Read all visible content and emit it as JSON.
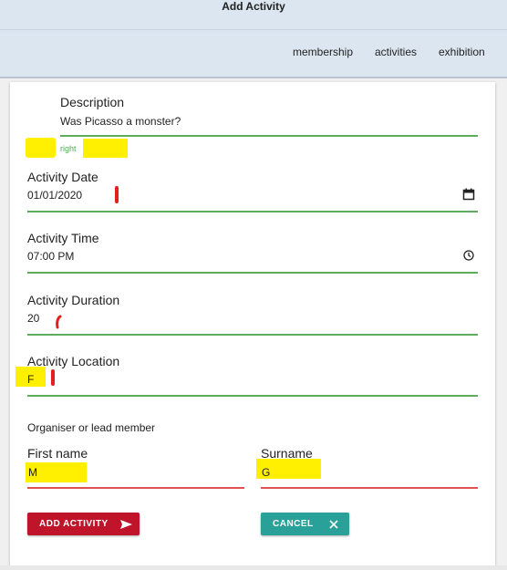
{
  "header": {
    "title": "Add Activity",
    "nav": [
      "membership",
      "activities",
      "exhibition"
    ]
  },
  "form": {
    "description": {
      "label": "Description",
      "value": "Was Picasso a monster?",
      "hint": "right"
    },
    "date": {
      "label": "Activity Date",
      "value": "01/01/2020"
    },
    "time": {
      "label": "Activity Time",
      "value": "07:00 PM"
    },
    "duration": {
      "label": "Activity Duration",
      "value": "20"
    },
    "location": {
      "label": "Activity Location",
      "value": "F"
    },
    "organiser_heading": "Organiser or lead member",
    "first_name": {
      "label": "First name",
      "value": "M"
    },
    "surname": {
      "label": "Surname",
      "value": "G"
    }
  },
  "buttons": {
    "add": "ADD ACTIVITY",
    "cancel": "CANCEL"
  },
  "colors": {
    "valid": "#5cac5c",
    "invalid": "#e05252",
    "add": "#c0142b",
    "cancel": "#2aa198",
    "highlight": "#ffef00"
  }
}
